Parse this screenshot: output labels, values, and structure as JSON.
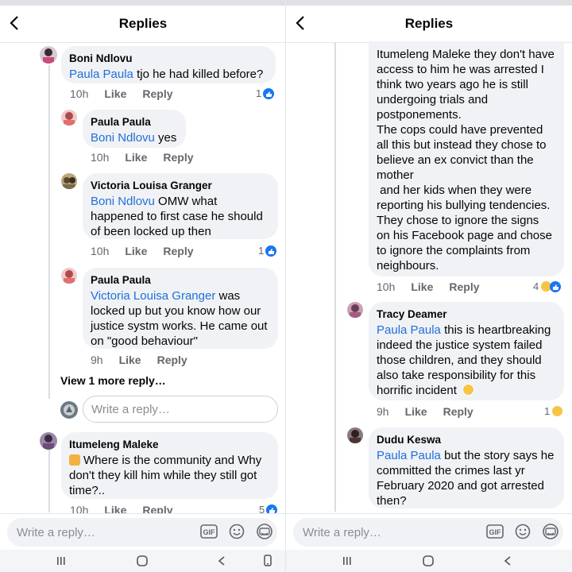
{
  "left": {
    "header_title": "Replies",
    "comments": [
      {
        "author": "Boni Ndlovu",
        "mention": "Paula Paula",
        "text": " tjo he had killed before?",
        "time": "10h",
        "like": "Like",
        "reply": "Reply",
        "reactions": "1"
      },
      {
        "author": "Paula Paula",
        "mention": "Boni Ndlovu",
        "text": " yes",
        "time": "10h",
        "like": "Like",
        "reply": "Reply"
      },
      {
        "author": "Victoria Louisa Granger",
        "mention": "Boni Ndlovu",
        "text": " OMW what happened to first case he should of been locked up then",
        "time": "10h",
        "like": "Like",
        "reply": "Reply",
        "reactions": "1"
      },
      {
        "author": "Paula Paula",
        "mention": "Victoria Louisa Granger",
        "text": " was locked up but you know how our justice systm works. He came out on \"good behaviour\"",
        "time": "9h",
        "like": "Like",
        "reply": "Reply"
      },
      {
        "author": "Itumeleng Maleke",
        "text": "Where is the community and Why don't they kill him while they still got time?..",
        "time": "10h",
        "like": "Like",
        "reply": "Reply",
        "reactions": "5"
      }
    ],
    "view_more": "View 1 more reply…",
    "reply_placeholder": "Write a reply…",
    "bottom_placeholder": "Write a reply…",
    "gif_label": "GIF"
  },
  "right": {
    "header_title": "Replies",
    "comments": [
      {
        "text_lines": [
          "Itumeleng Maleke they don't have",
          "access to him he was arrested I",
          "think two years ago he is still",
          "undergoing trials and",
          "postponements.",
          "The cops could have prevented",
          "all this but instead they chose to",
          "believe an ex convict than the",
          "mother",
          " and her kids when they were",
          "reporting his bullying tendencies.",
          "They chose to ignore the signs",
          "on his Facebook page and chose",
          "to ignore the complaints from",
          "neighbours."
        ],
        "time": "10h",
        "like": "Like",
        "reply": "Reply",
        "reactions": "4"
      },
      {
        "author": "Tracy Deamer",
        "mention": "Paula Paula",
        "text": " this is heartbreaking indeed the justice system failed those children, and they should also take responsibility for this horrific incident",
        "time": "9h",
        "like": "Like",
        "reply": "Reply",
        "reactions": "1"
      },
      {
        "author": "Dudu Keswa",
        "mention": "Paula Paula",
        "text": " but the story says he committed the crimes last yr February 2020 and got arrested then?"
      }
    ],
    "bottom_placeholder": "Write a reply…",
    "gif_label": "GIF"
  },
  "colors": {
    "mention": "#216fdb",
    "bubble": "#f0f2f5",
    "like_blue": "#1877f2"
  }
}
